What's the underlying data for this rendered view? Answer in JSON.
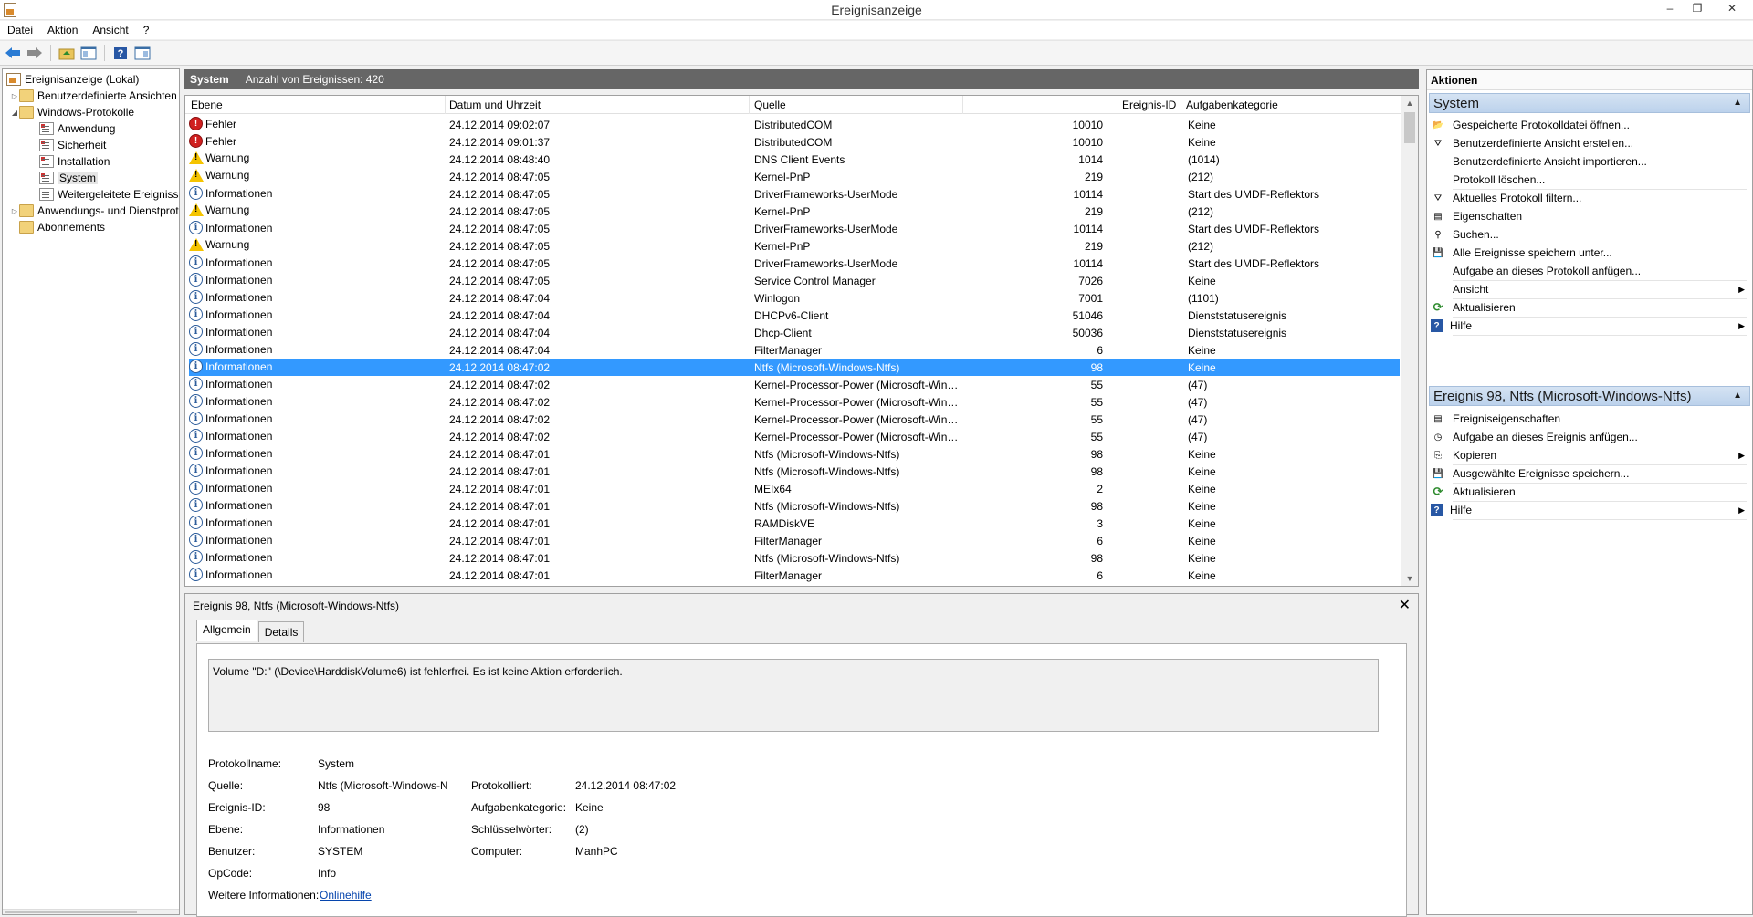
{
  "window": {
    "title": "Ereignisanzeige",
    "minimize": "–",
    "maximize": "❐",
    "close": "✕"
  },
  "menu": [
    "Datei",
    "Aktion",
    "Ansicht",
    "?"
  ],
  "tree": {
    "root": "Ereignisanzeige (Lokal)",
    "custom_views": "Benutzerdefinierte Ansichten",
    "windows_logs": "Windows-Protokolle",
    "logs": [
      "Anwendung",
      "Sicherheit",
      "Installation",
      "System",
      "Weitergeleitete Ereignisse"
    ],
    "apps_services": "Anwendungs- und Dienstprotokolle",
    "subscriptions": "Abonnements"
  },
  "center": {
    "log_name": "System",
    "count_label": "Anzahl von Ereignissen: 420"
  },
  "columns": {
    "level": "Ebene",
    "datetime": "Datum und Uhrzeit",
    "source": "Quelle",
    "event_id": "Ereignis-ID",
    "category": "Aufgabenkategorie"
  },
  "events": [
    {
      "level": "Fehler",
      "type": "err",
      "dt": "24.12.2014 09:02:07",
      "src": "DistributedCOM",
      "id": "10010",
      "cat": "Keine"
    },
    {
      "level": "Fehler",
      "type": "err",
      "dt": "24.12.2014 09:01:37",
      "src": "DistributedCOM",
      "id": "10010",
      "cat": "Keine"
    },
    {
      "level": "Warnung",
      "type": "warn",
      "dt": "24.12.2014 08:48:40",
      "src": "DNS Client Events",
      "id": "1014",
      "cat": "(1014)"
    },
    {
      "level": "Warnung",
      "type": "warn",
      "dt": "24.12.2014 08:47:05",
      "src": "Kernel-PnP",
      "id": "219",
      "cat": "(212)"
    },
    {
      "level": "Informationen",
      "type": "info",
      "dt": "24.12.2014 08:47:05",
      "src": "DriverFrameworks-UserMode",
      "id": "10114",
      "cat": "Start des UMDF-Reflektors"
    },
    {
      "level": "Warnung",
      "type": "warn",
      "dt": "24.12.2014 08:47:05",
      "src": "Kernel-PnP",
      "id": "219",
      "cat": "(212)"
    },
    {
      "level": "Informationen",
      "type": "info",
      "dt": "24.12.2014 08:47:05",
      "src": "DriverFrameworks-UserMode",
      "id": "10114",
      "cat": "Start des UMDF-Reflektors"
    },
    {
      "level": "Warnung",
      "type": "warn",
      "dt": "24.12.2014 08:47:05",
      "src": "Kernel-PnP",
      "id": "219",
      "cat": "(212)"
    },
    {
      "level": "Informationen",
      "type": "info",
      "dt": "24.12.2014 08:47:05",
      "src": "DriverFrameworks-UserMode",
      "id": "10114",
      "cat": "Start des UMDF-Reflektors"
    },
    {
      "level": "Informationen",
      "type": "info",
      "dt": "24.12.2014 08:47:05",
      "src": "Service Control Manager",
      "id": "7026",
      "cat": "Keine"
    },
    {
      "level": "Informationen",
      "type": "info",
      "dt": "24.12.2014 08:47:04",
      "src": "Winlogon",
      "id": "7001",
      "cat": "(1101)"
    },
    {
      "level": "Informationen",
      "type": "info",
      "dt": "24.12.2014 08:47:04",
      "src": "DHCPv6-Client",
      "id": "51046",
      "cat": "Dienststatusereignis"
    },
    {
      "level": "Informationen",
      "type": "info",
      "dt": "24.12.2014 08:47:04",
      "src": "Dhcp-Client",
      "id": "50036",
      "cat": "Dienststatusereignis"
    },
    {
      "level": "Informationen",
      "type": "info",
      "dt": "24.12.2014 08:47:04",
      "src": "FilterManager",
      "id": "6",
      "cat": "Keine"
    },
    {
      "level": "Informationen",
      "type": "info",
      "dt": "24.12.2014 08:47:02",
      "src": "Ntfs (Microsoft-Windows-Ntfs)",
      "id": "98",
      "cat": "Keine",
      "selected": true
    },
    {
      "level": "Informationen",
      "type": "info",
      "dt": "24.12.2014 08:47:02",
      "src": "Kernel-Processor-Power (Microsoft-Wind...",
      "id": "55",
      "cat": "(47)"
    },
    {
      "level": "Informationen",
      "type": "info",
      "dt": "24.12.2014 08:47:02",
      "src": "Kernel-Processor-Power (Microsoft-Wind...",
      "id": "55",
      "cat": "(47)"
    },
    {
      "level": "Informationen",
      "type": "info",
      "dt": "24.12.2014 08:47:02",
      "src": "Kernel-Processor-Power (Microsoft-Wind...",
      "id": "55",
      "cat": "(47)"
    },
    {
      "level": "Informationen",
      "type": "info",
      "dt": "24.12.2014 08:47:02",
      "src": "Kernel-Processor-Power (Microsoft-Wind...",
      "id": "55",
      "cat": "(47)"
    },
    {
      "level": "Informationen",
      "type": "info",
      "dt": "24.12.2014 08:47:01",
      "src": "Ntfs (Microsoft-Windows-Ntfs)",
      "id": "98",
      "cat": "Keine"
    },
    {
      "level": "Informationen",
      "type": "info",
      "dt": "24.12.2014 08:47:01",
      "src": "Ntfs (Microsoft-Windows-Ntfs)",
      "id": "98",
      "cat": "Keine"
    },
    {
      "level": "Informationen",
      "type": "info",
      "dt": "24.12.2014 08:47:01",
      "src": "MEIx64",
      "id": "2",
      "cat": "Keine"
    },
    {
      "level": "Informationen",
      "type": "info",
      "dt": "24.12.2014 08:47:01",
      "src": "Ntfs (Microsoft-Windows-Ntfs)",
      "id": "98",
      "cat": "Keine"
    },
    {
      "level": "Informationen",
      "type": "info",
      "dt": "24.12.2014 08:47:01",
      "src": "RAMDiskVE",
      "id": "3",
      "cat": "Keine"
    },
    {
      "level": "Informationen",
      "type": "info",
      "dt": "24.12.2014 08:47:01",
      "src": "FilterManager",
      "id": "6",
      "cat": "Keine"
    },
    {
      "level": "Informationen",
      "type": "info",
      "dt": "24.12.2014 08:47:01",
      "src": "Ntfs (Microsoft-Windows-Ntfs)",
      "id": "98",
      "cat": "Keine"
    },
    {
      "level": "Informationen",
      "type": "info",
      "dt": "24.12.2014 08:47:01",
      "src": "FilterManager",
      "id": "6",
      "cat": "Keine"
    }
  ],
  "detail": {
    "header": "Ereignis 98, Ntfs (Microsoft-Windows-Ntfs)",
    "close": "✕",
    "tabs": [
      "Allgemein",
      "Details"
    ],
    "message": "Volume \"D:\" (\\Device\\HarddiskVolume6) ist fehlerfrei. Es ist keine Aktion erforderlich.",
    "labels": {
      "log_name": "Protokollname:",
      "source": "Quelle:",
      "event_id": "Ereignis-ID:",
      "level": "Ebene:",
      "user": "Benutzer:",
      "opcode": "OpCode:",
      "more_info": "Weitere Informationen:",
      "logged": "Protokolliert:",
      "task_cat": "Aufgabenkategorie:",
      "keywords": "Schlüsselwörter:",
      "computer": "Computer:"
    },
    "values": {
      "log_name": "System",
      "source": "Ntfs (Microsoft-Windows-N",
      "event_id": "98",
      "level": "Informationen",
      "user": "SYSTEM",
      "opcode": "Info",
      "more_info": "Onlinehilfe",
      "logged": "24.12.2014 08:47:02",
      "task_cat": "Keine",
      "keywords": "(2)",
      "computer": "ManhPC"
    }
  },
  "actions": {
    "header": "Aktionen",
    "section_system": "System",
    "system_items": [
      "Gespeicherte Protokolldatei öffnen...",
      "Benutzerdefinierte Ansicht erstellen...",
      "Benutzerdefinierte Ansicht importieren...",
      "Protokoll löschen...",
      "Aktuelles Protokoll filtern...",
      "Eigenschaften",
      "Suchen...",
      "Alle Ereignisse speichern unter...",
      "Aufgabe an dieses Protokoll anfügen...",
      "Ansicht",
      "Aktualisieren",
      "Hilfe"
    ],
    "section_event": "Ereignis 98, Ntfs (Microsoft-Windows-Ntfs)",
    "event_items": [
      "Ereigniseigenschaften",
      "Aufgabe an dieses Ereignis anfügen...",
      "Kopieren",
      "Ausgewählte Ereignisse speichern...",
      "Aktualisieren",
      "Hilfe"
    ]
  }
}
